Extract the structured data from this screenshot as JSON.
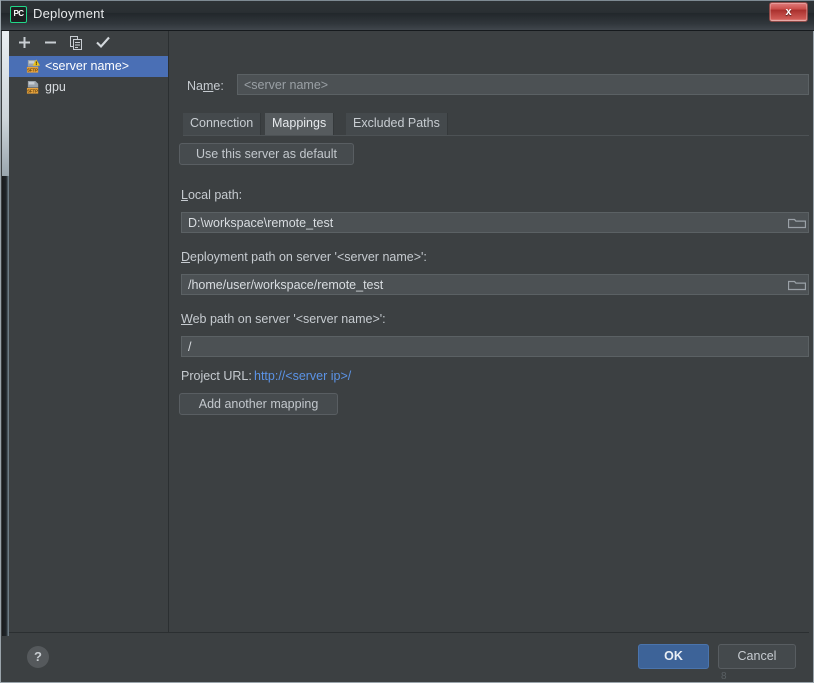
{
  "window": {
    "title": "Deployment",
    "app_icon": "pycharm-icon",
    "app_icon_text": "PC",
    "close_label": "x"
  },
  "sidebar": {
    "toolbar": [
      {
        "name": "add-server-button",
        "icon": "plus-icon",
        "label": "+"
      },
      {
        "name": "remove-server-button",
        "icon": "minus-icon",
        "label": "−"
      },
      {
        "name": "copy-server-button",
        "icon": "copy-icon",
        "label": "copy"
      },
      {
        "name": "set-default-button",
        "icon": "check-icon",
        "label": "✓"
      }
    ],
    "items": [
      {
        "label": "<server name>",
        "icon": "sftp-warning-icon",
        "selected": true
      },
      {
        "label": "gpu",
        "icon": "sftp-icon",
        "selected": false
      }
    ]
  },
  "form": {
    "name_label_pre": "Na",
    "name_label_mnemonic": "m",
    "name_label_post": "e:",
    "name_value": "<server name>",
    "name_placeholder": "<server name>"
  },
  "tabs": [
    {
      "label": "Connection",
      "active": false
    },
    {
      "label": "Mappings",
      "active": true
    },
    {
      "label": "Excluded Paths",
      "active": false
    }
  ],
  "mappings": {
    "default_button_label": "Use this server as default",
    "local_path": {
      "label_mnemonic": "L",
      "label_rest": "ocal path:",
      "value": "D:\\workspace\\remote_test",
      "browse_icon": "folder-icon"
    },
    "deployment_path": {
      "label_mnemonic": "D",
      "label_rest": "eployment path on server '<server name>':",
      "value": "/home/user/workspace/remote_test",
      "browse_icon": "folder-icon"
    },
    "web_path": {
      "label_mnemonic": "W",
      "label_rest": "eb path on server '<server name>':",
      "value": "/"
    },
    "project_url": {
      "label": "Project URL:",
      "link": "http://<server ip>/"
    },
    "add_mapping_label": "Add another mapping"
  },
  "footer": {
    "help_label": "?",
    "ok_label": "OK",
    "cancel_label": "Cancel",
    "artifact": "8"
  },
  "colors": {
    "dialog_bg": "#3c4042",
    "input_bg": "#4c5154",
    "selection_blue": "#4a6fb5",
    "link_blue": "#5b93e6",
    "ok_blue": "#3d6398",
    "accent_green": "#21d789",
    "close_red": "#c94a47"
  }
}
